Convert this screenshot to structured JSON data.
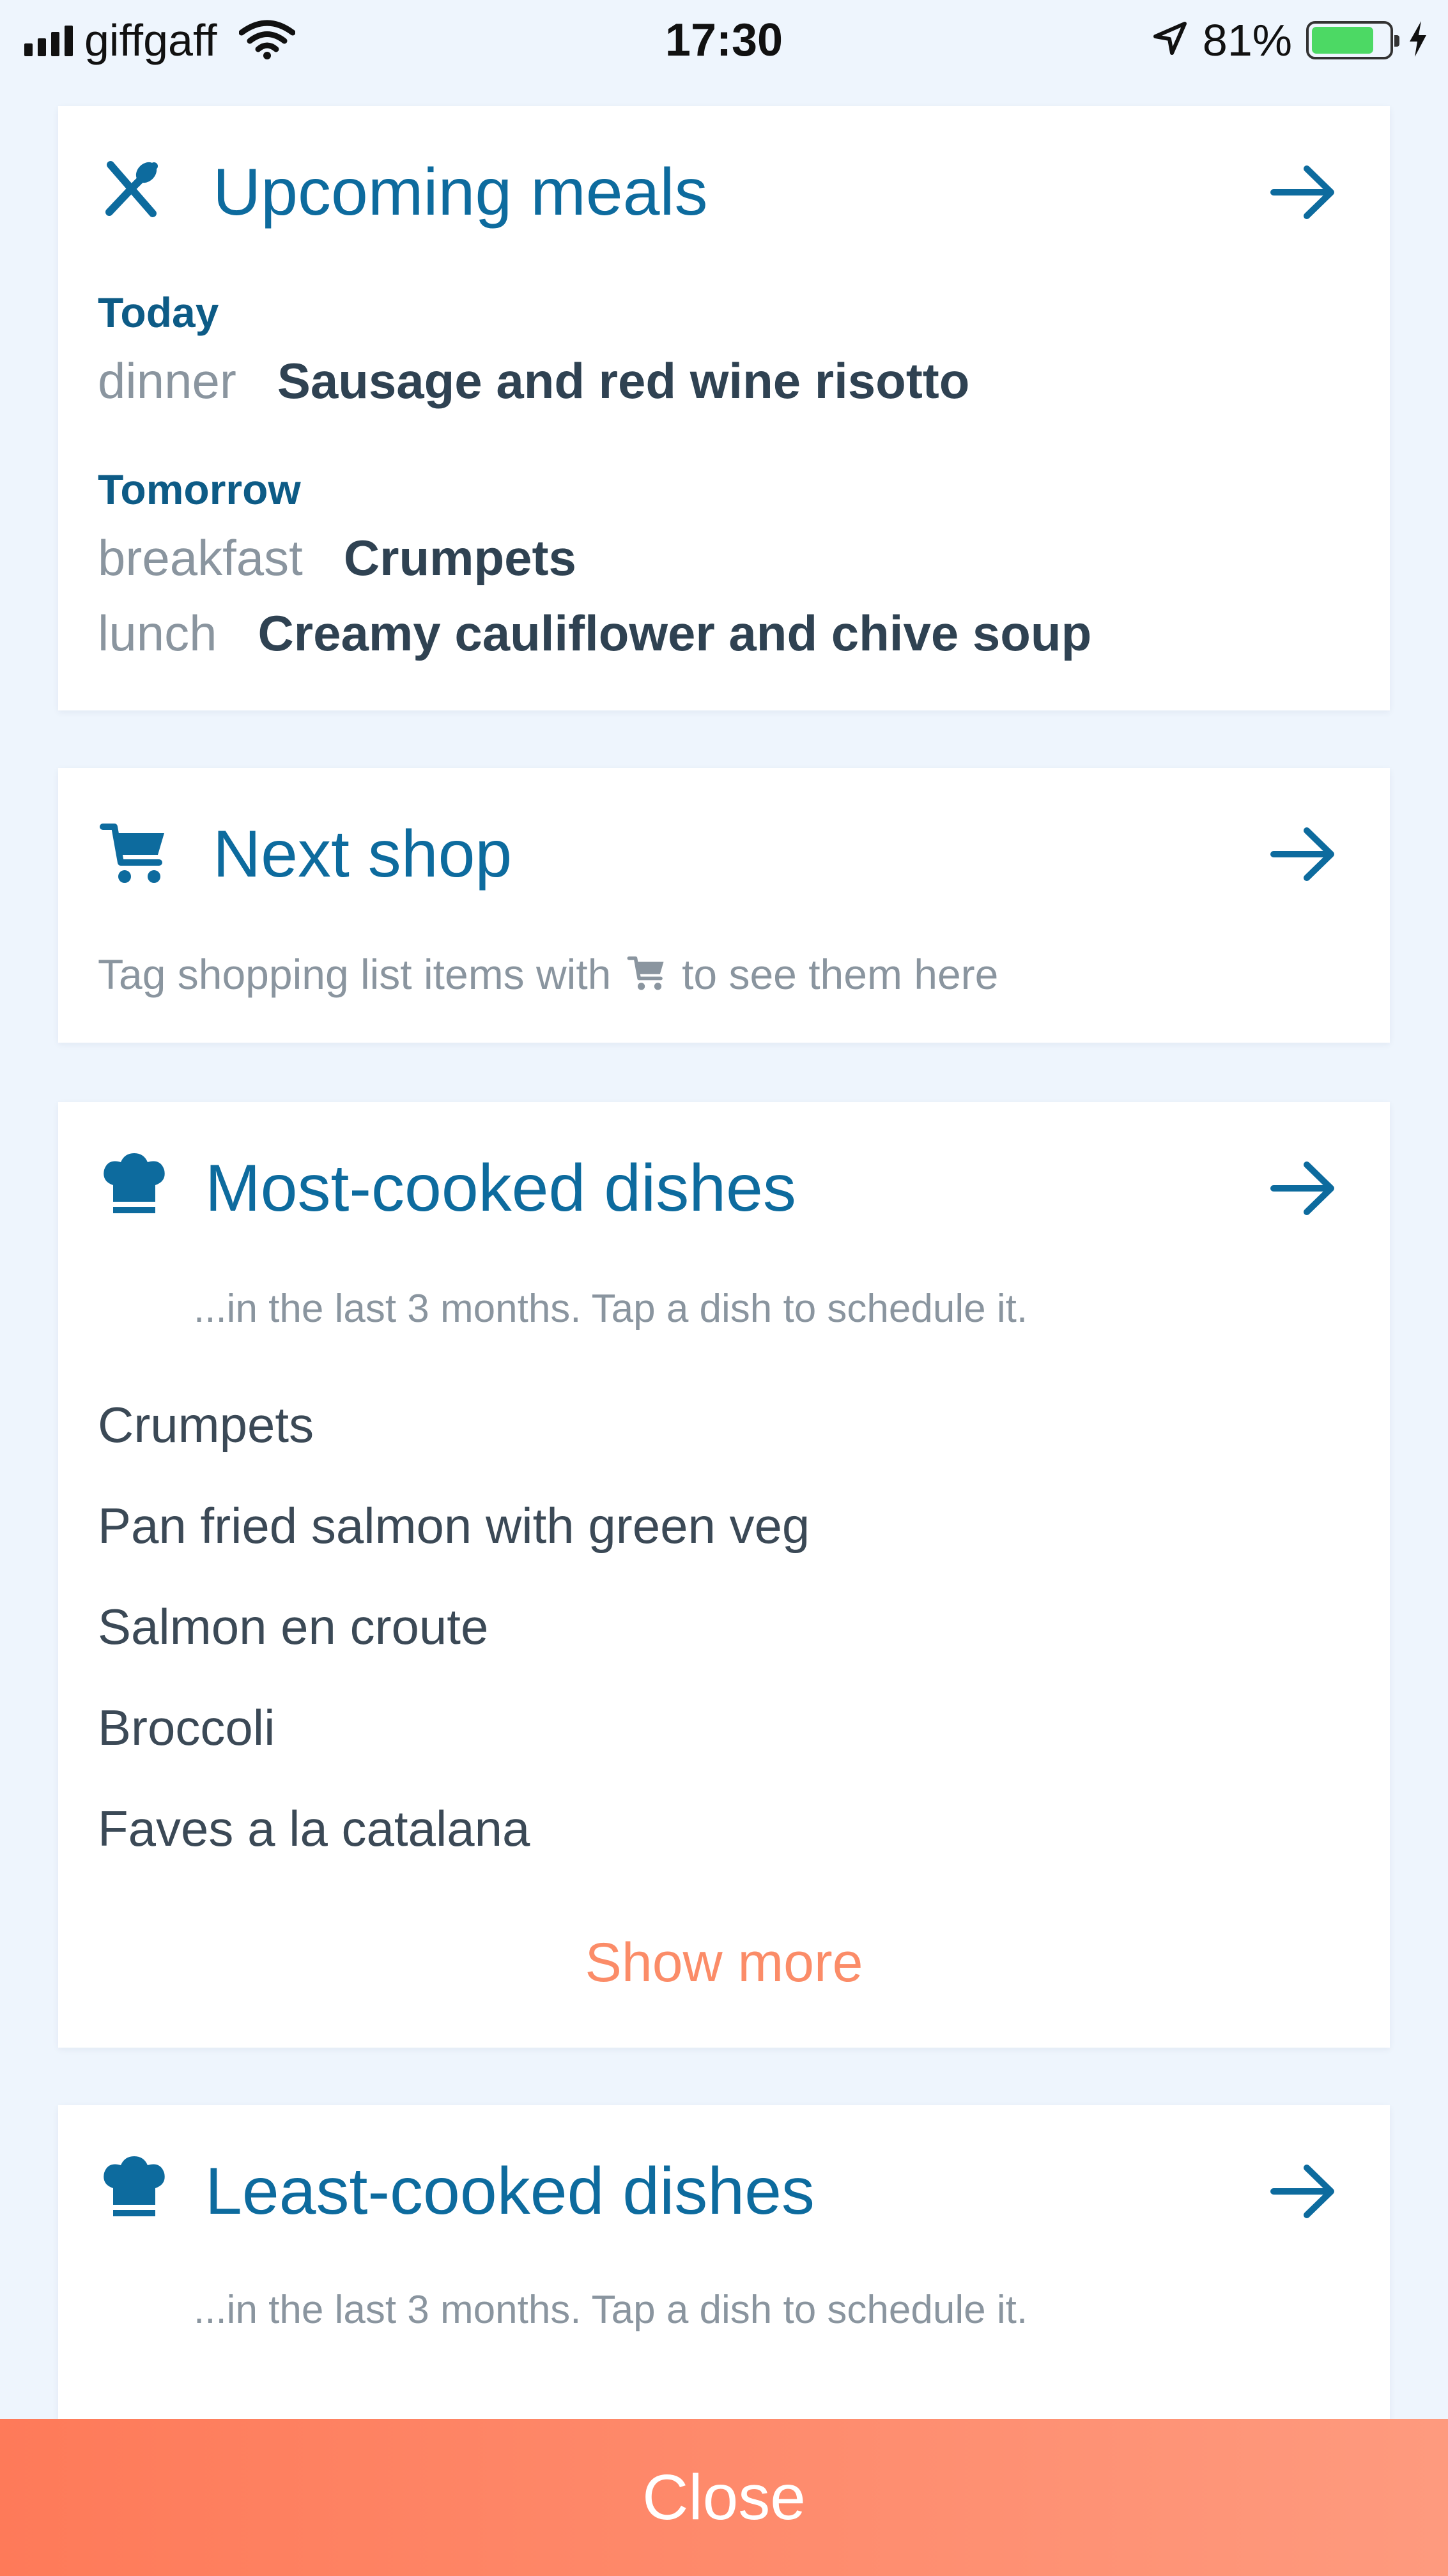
{
  "status_bar": {
    "carrier": "giffgaff",
    "time": "17:30",
    "battery_percent": "81%",
    "battery_level": 0.81
  },
  "upcoming_meals": {
    "title": "Upcoming meals",
    "today_label": "Today",
    "today_items": [
      {
        "type": "dinner",
        "dish": "Sausage and red wine risotto"
      }
    ],
    "tomorrow_label": "Tomorrow",
    "tomorrow_items": [
      {
        "type": "breakfast",
        "dish": "Crumpets"
      },
      {
        "type": "lunch",
        "dish": "Creamy cauliflower and chive soup"
      }
    ]
  },
  "next_shop": {
    "title": "Next shop",
    "hint_before": "Tag shopping list items with",
    "hint_after": "to see them here"
  },
  "most_cooked": {
    "title": "Most-cooked dishes",
    "subtitle": "...in the last 3 months. Tap a dish to schedule it.",
    "dishes": [
      "Crumpets",
      "Pan fried salmon with green veg",
      "Salmon en croute",
      "Broccoli",
      "Faves a la catalana"
    ],
    "show_more": "Show more"
  },
  "least_cooked": {
    "title": "Least-cooked dishes",
    "subtitle": "...in the last 3 months. Tap a dish to schedule it."
  },
  "close_label": "Close",
  "colors": {
    "accent": "#0d6b9e",
    "show_more": "#fb8c68",
    "close_bar": "#fe8a6b",
    "background": "#eef5fd"
  },
  "icons": {
    "upcoming": "fork-knife-icon",
    "next_shop": "shopping-cart-icon",
    "most_cooked": "chef-hat-icon",
    "least_cooked": "chef-hat-icon",
    "arrow": "arrow-right-icon"
  }
}
